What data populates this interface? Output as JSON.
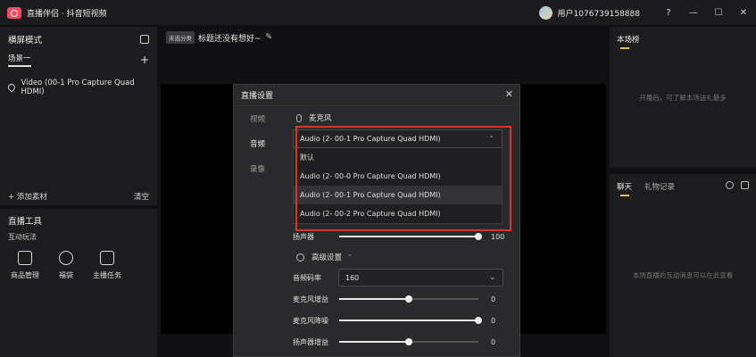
{
  "titlebar": {
    "app_title": "直播伴侣 · 抖音短视频",
    "username": "用户1076739158888",
    "help": "?",
    "minimize": "—",
    "maximize": "☐",
    "close": "✕"
  },
  "left": {
    "mode_title": "横屏模式",
    "scene_tab": "场景一",
    "add_scene": "+",
    "source_item": "Video (00-1 Pro Capture Quad HDMI)",
    "add_material": "+ 添加素材",
    "clear": "清空",
    "tools_title": "直播工具",
    "tools_sub": "互动玩法",
    "tools": [
      {
        "label": "商品管理",
        "icon": "shop-icon"
      },
      {
        "label": "福袋",
        "icon": "gift-bag-icon"
      },
      {
        "label": "主播任务",
        "icon": "task-icon"
      }
    ]
  },
  "center": {
    "badge": "未选分类",
    "live_title": "标题还没有想好~",
    "edit_icon": "✎"
  },
  "right": {
    "rank_tab": "本场榜",
    "rank_empty": "开播后，可了解本场送礼最多",
    "chat_tab": "聊天",
    "gift_tab": "礼物记录",
    "chat_empty": "本场直播的互动消息可以在此查看"
  },
  "dialog": {
    "title": "直播设置",
    "close": "✕",
    "nav": [
      "视频",
      "音频",
      "录像"
    ],
    "mic_title": "麦克风",
    "mic_selected": "Audio (2- 00-1 Pro Capture Quad HDMI)",
    "chevron": "⌃",
    "mic_options": [
      "默认",
      "Audio (2- 00-0 Pro Capture Quad HDMI)",
      "Audio (2- 00-1 Pro Capture Quad HDMI)",
      "Audio (2- 00-2 Pro Capture Quad HDMI)"
    ],
    "speaker_label": "扬声器",
    "speaker_value": "100",
    "speaker_level": 1.0,
    "advanced_title": "高级设置",
    "advanced_chev": "⌃",
    "bitrate_label": "音频码率",
    "bitrate_value": "160",
    "bitrate_chev": "⌄",
    "mic_gain_label": "麦克风增益",
    "mic_gain_value": "0",
    "mic_gain_level": 0.5,
    "mic_denoise_label": "麦克风降噪",
    "mic_denoise_value": "0",
    "mic_denoise_level": 1.0,
    "speaker_gain_label": "扬声器增益",
    "speaker_gain_value": "0",
    "speaker_gain_level": 0.5
  },
  "colors": {
    "accent_red": "#d9332b",
    "logo": "#f44a5c",
    "tab_underline": "#e6c14a"
  }
}
